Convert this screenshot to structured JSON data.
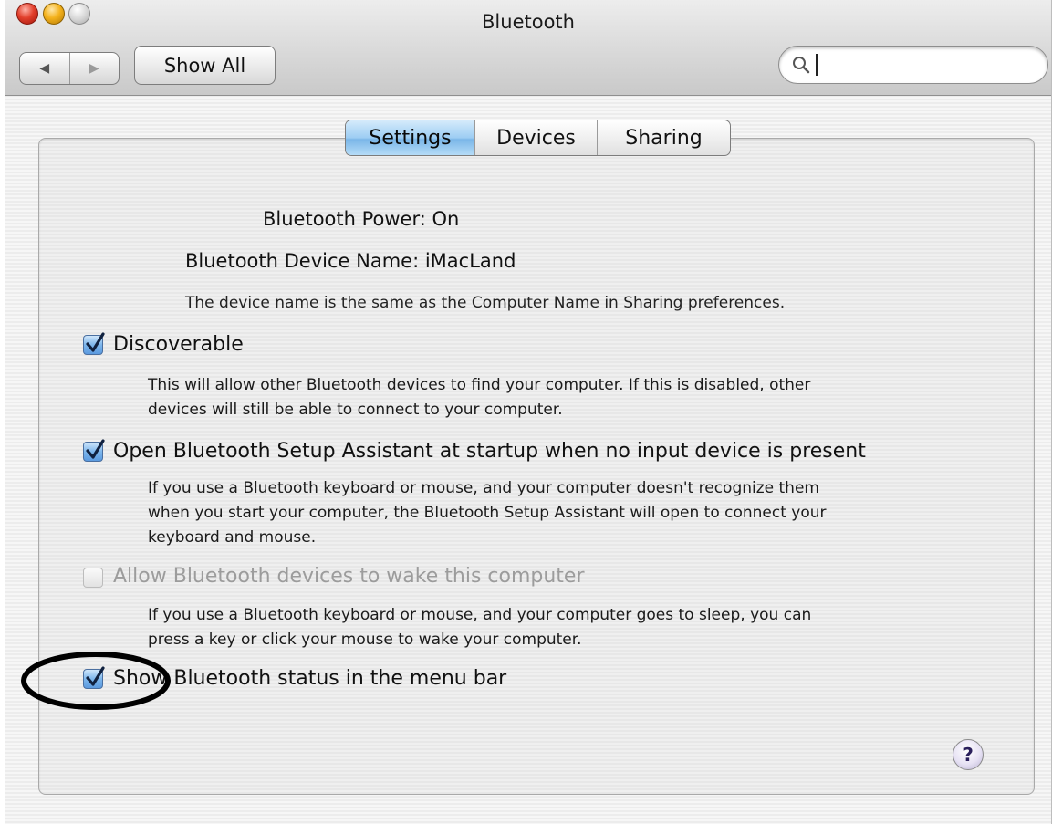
{
  "window": {
    "title": "Bluetooth"
  },
  "toolbar": {
    "back_glyph": "◀",
    "forward_glyph": "▶",
    "show_all_label": "Show All",
    "search_value": ""
  },
  "tabs": [
    {
      "label": "Settings",
      "selected": true
    },
    {
      "label": "Devices",
      "selected": false
    },
    {
      "label": "Sharing",
      "selected": false
    }
  ],
  "settings": {
    "power_label": "Bluetooth Power:",
    "power_value": "On",
    "name_label": "Bluetooth Device Name:",
    "name_value": "iMacLand",
    "name_note": "The device name is the same as the Computer Name in Sharing preferences.",
    "options": [
      {
        "label": "Discoverable",
        "checked": true,
        "enabled": true,
        "description": [
          "This will allow other Bluetooth devices to find your computer.  If this is disabled, other",
          "devices will still be able to connect to your computer."
        ]
      },
      {
        "label": "Open Bluetooth Setup Assistant at startup when no input device is present",
        "checked": true,
        "enabled": true,
        "description": [
          "If you use a Bluetooth keyboard or mouse, and your computer doesn't recognize them",
          "when you start your computer, the Bluetooth Setup Assistant will open to connect your",
          "keyboard and mouse."
        ]
      },
      {
        "label": "Allow Bluetooth devices to wake this computer",
        "checked": false,
        "enabled": false,
        "description": [
          "If you use a Bluetooth keyboard or mouse, and your computer goes to sleep, you can",
          "press a key or click your mouse to wake your computer."
        ]
      },
      {
        "label": "Show Bluetooth status in the menu bar",
        "checked": true,
        "enabled": true,
        "description": []
      }
    ]
  },
  "help": {
    "glyph": "?"
  },
  "colors": {
    "selected_tab": "#9dcdf3",
    "checkbox": "#5b9adf",
    "annotation": "#000000"
  },
  "icons": [
    "search-icon",
    "help-icon",
    "checkmark-icon"
  ]
}
